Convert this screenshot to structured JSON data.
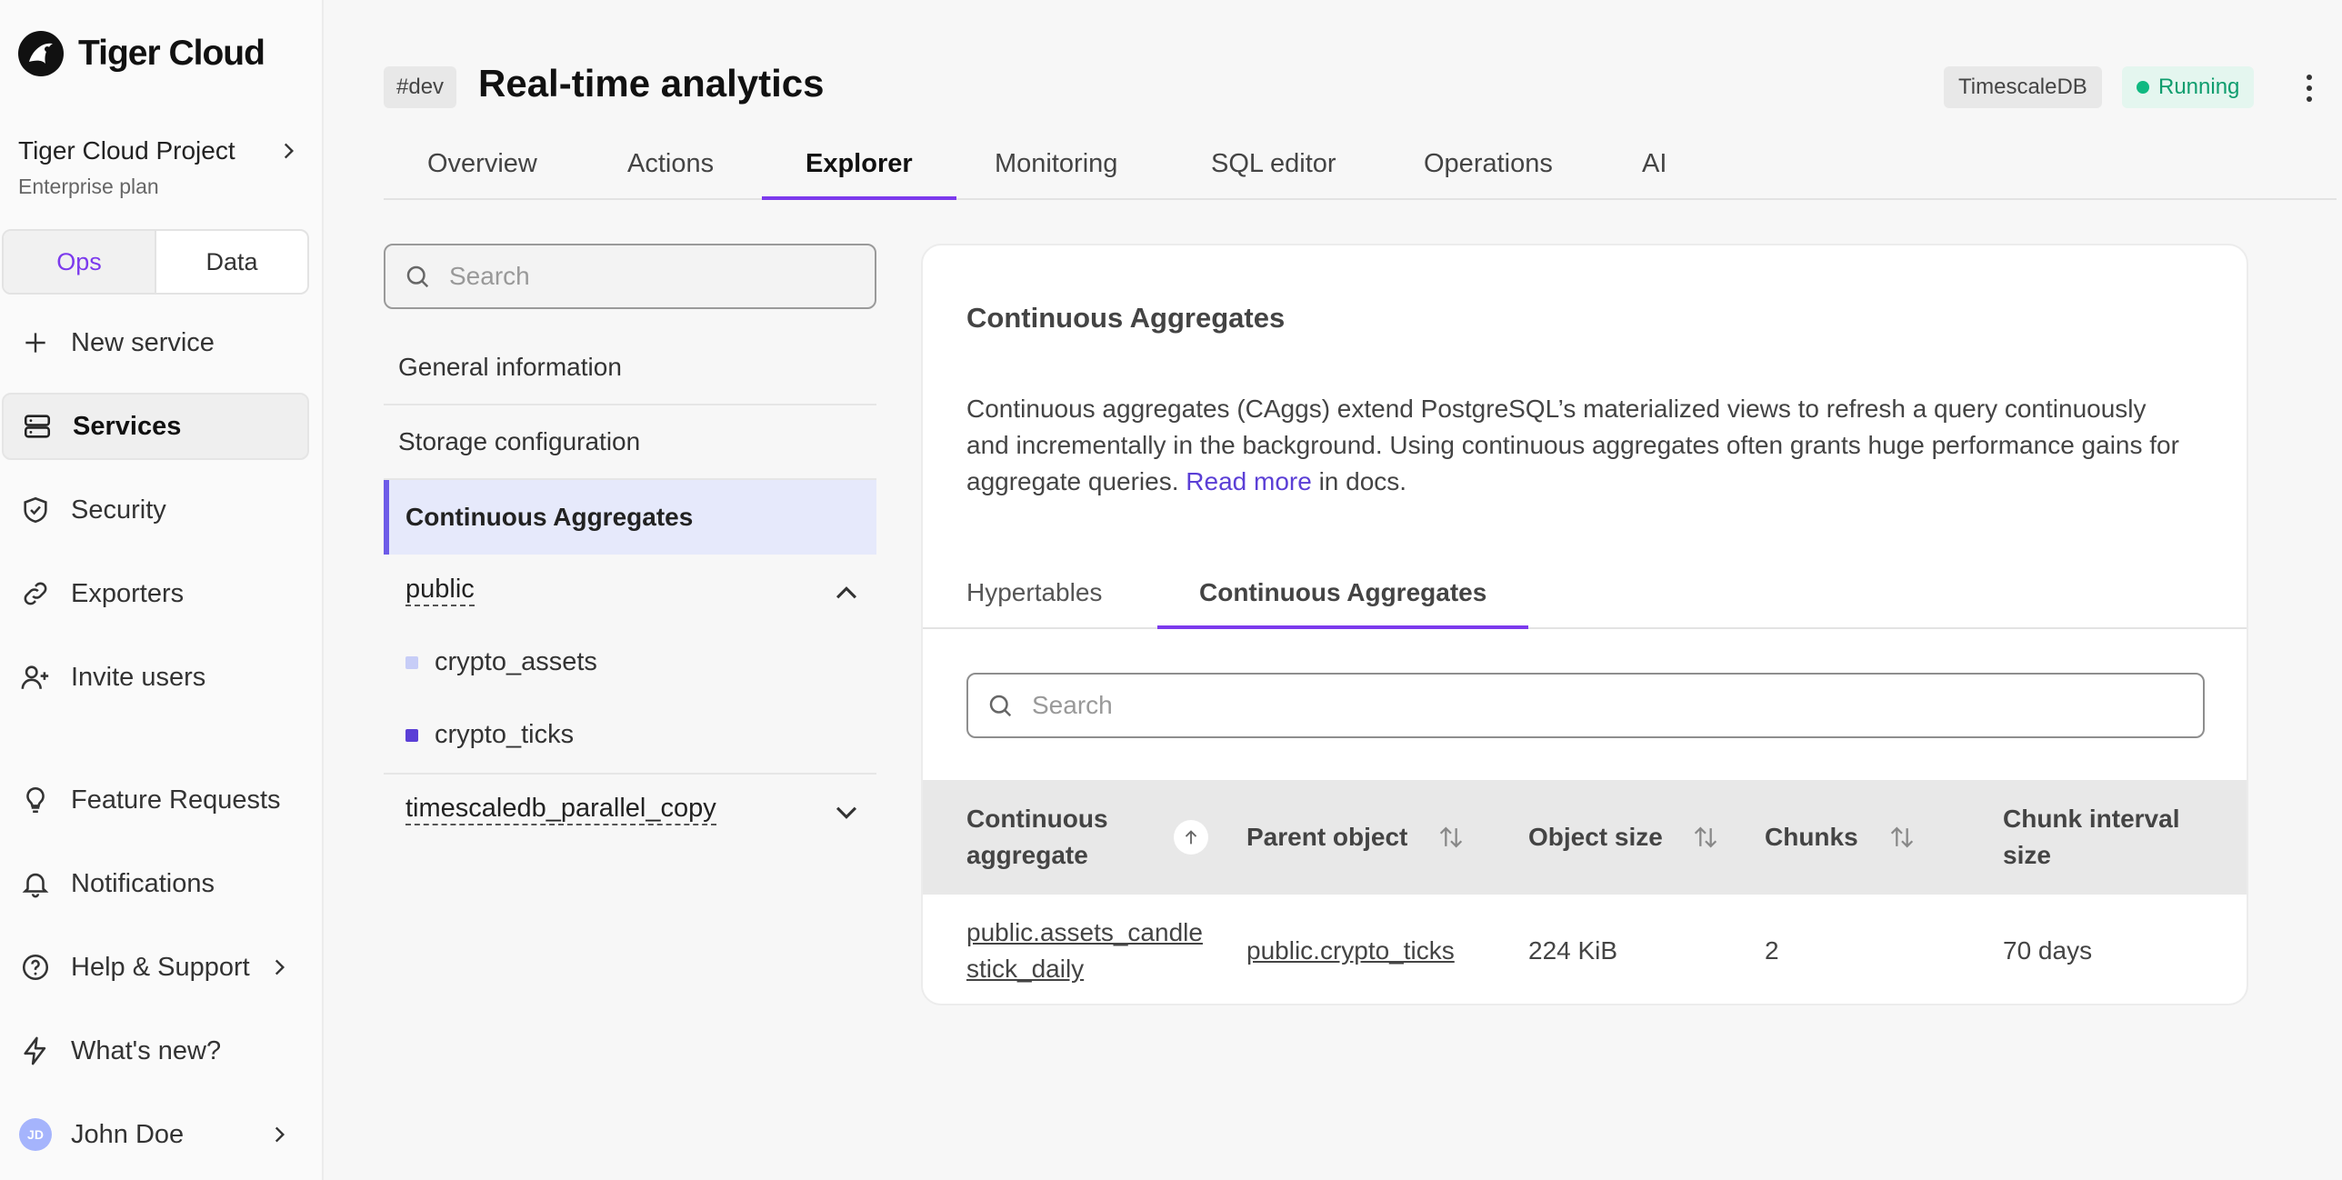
{
  "app": {
    "name": "Tiger Cloud"
  },
  "project": {
    "name": "Tiger Cloud Project",
    "plan": "Enterprise plan"
  },
  "mode_toggle": {
    "ops": "Ops",
    "data": "Data"
  },
  "sidebar": {
    "items": [
      {
        "label": "New service",
        "icon": "plus-icon"
      },
      {
        "label": "Services",
        "icon": "server-icon"
      },
      {
        "label": "Security",
        "icon": "shield-check-icon"
      },
      {
        "label": "Exporters",
        "icon": "link-icon"
      },
      {
        "label": "Invite users",
        "icon": "user-plus-icon"
      },
      {
        "label": "Feature Requests",
        "icon": "lightbulb-icon"
      },
      {
        "label": "Notifications",
        "icon": "bell-icon"
      },
      {
        "label": "Help & Support",
        "icon": "help-circle-icon"
      },
      {
        "label": "What's new?",
        "icon": "zap-icon"
      }
    ],
    "user": {
      "initials": "JD",
      "name": "John Doe"
    }
  },
  "header": {
    "tag": "#dev",
    "title": "Real-time analytics",
    "db_badge": "TimescaleDB",
    "status": "Running",
    "status_color": "#10b981"
  },
  "tabs": [
    "Overview",
    "Actions",
    "Explorer",
    "Monitoring",
    "SQL editor",
    "Operations",
    "AI"
  ],
  "explorer": {
    "search_placeholder": "Search",
    "items": [
      "General information",
      "Storage configuration",
      "Continuous Aggregates"
    ],
    "schemas": [
      {
        "name": "public",
        "tables": [
          "crypto_assets",
          "crypto_ticks"
        ]
      },
      {
        "name": "timescaledb_parallel_copy"
      }
    ]
  },
  "card": {
    "title": "Continuous Aggregates",
    "desc_before": "Continuous aggregates (CAggs) extend PostgreSQL’s materialized views to refresh a query continuously and incrementally in the background. Using continuous aggregates often grants huge performance gains for aggregate queries. ",
    "desc_link": "Read more",
    "desc_after": " in docs.",
    "tabs": [
      "Hypertables",
      "Continuous Aggregates"
    ],
    "search_placeholder": "Search",
    "columns": [
      "Continuous aggregate",
      "Parent object",
      "Object size",
      "Chunks",
      "Chunk interval size"
    ],
    "rows": [
      {
        "name": "public.assets_candlestick_daily",
        "parent": "public.crypto_ticks",
        "size": "224 KiB",
        "chunks": "2",
        "interval": "70 days"
      }
    ]
  },
  "colors": {
    "accent": "#7c3aed",
    "link": "#5b3fd6",
    "active_bg": "#e6e9fb"
  }
}
